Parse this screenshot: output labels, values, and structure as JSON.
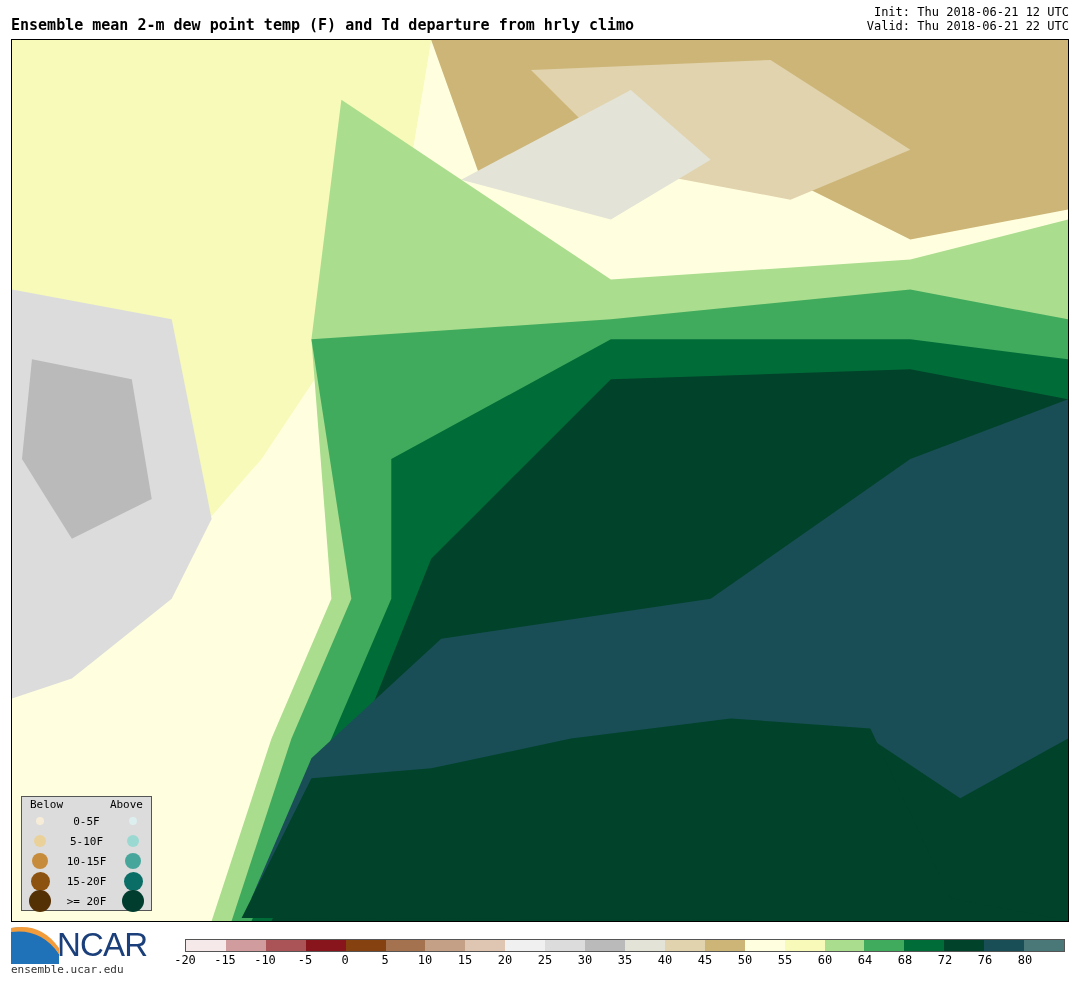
{
  "title": "Ensemble mean 2-m dew point temp (F) and Td departure from hrly climo",
  "init": "Init: Thu 2018-06-21 12 UTC",
  "valid": "Valid: Thu 2018-06-21 22 UTC",
  "legend": {
    "below_heading": "Below",
    "above_heading": "Above",
    "rows": [
      {
        "label": "0-5F",
        "below": {
          "color": "#f6ecd8"
        },
        "above": {
          "color": "#dcefee"
        }
      },
      {
        "label": "5-10F",
        "below": {
          "color": "#ead19a"
        },
        "above": {
          "color": "#9ad9d2"
        }
      },
      {
        "label": "10-15F",
        "below": {
          "color": "#c68c3c"
        },
        "above": {
          "color": "#47a69b"
        }
      },
      {
        "label": "15-20F",
        "below": {
          "color": "#8c520f"
        },
        "above": {
          "color": "#0b6e66"
        }
      },
      {
        "label": ">= 20F",
        "below": {
          "color": "#543005"
        },
        "above": {
          "color": "#013d2f"
        }
      }
    ]
  },
  "logo": {
    "text": "NCAR",
    "url": "ensemble.ucar.edu"
  },
  "colorbar": [
    {
      "label": "-20",
      "color": "#f5e9ea"
    },
    {
      "label": "-15",
      "color": "#d19c9e"
    },
    {
      "label": "-10",
      "color": "#aa5457"
    },
    {
      "label": "-5",
      "color": "#88141c"
    },
    {
      "label": "0",
      "color": "#864110"
    },
    {
      "label": "5",
      "color": "#a5724f"
    },
    {
      "label": "10",
      "color": "#c4a086"
    },
    {
      "label": "15",
      "color": "#dec6b2"
    },
    {
      "label": "20",
      "color": "#f0f0f0"
    },
    {
      "label": "25",
      "color": "#dcdcdc"
    },
    {
      "label": "30",
      "color": "#bababa"
    },
    {
      "label": "35",
      "color": "#e3e3d7"
    },
    {
      "label": "40",
      "color": "#e1d3ad"
    },
    {
      "label": "45",
      "color": "#ccb577"
    },
    {
      "label": "50",
      "color": "#ffffdf"
    },
    {
      "label": "55",
      "color": "#f7fab8"
    },
    {
      "label": "60",
      "color": "#abdd8f"
    },
    {
      "label": "64",
      "color": "#41ab5d"
    },
    {
      "label": "68",
      "color": "#006d39"
    },
    {
      "label": "72",
      "color": "#00432a"
    },
    {
      "label": "76",
      "color": "#194e57"
    },
    {
      "label": "80",
      "color": "#4a7777"
    }
  ]
}
